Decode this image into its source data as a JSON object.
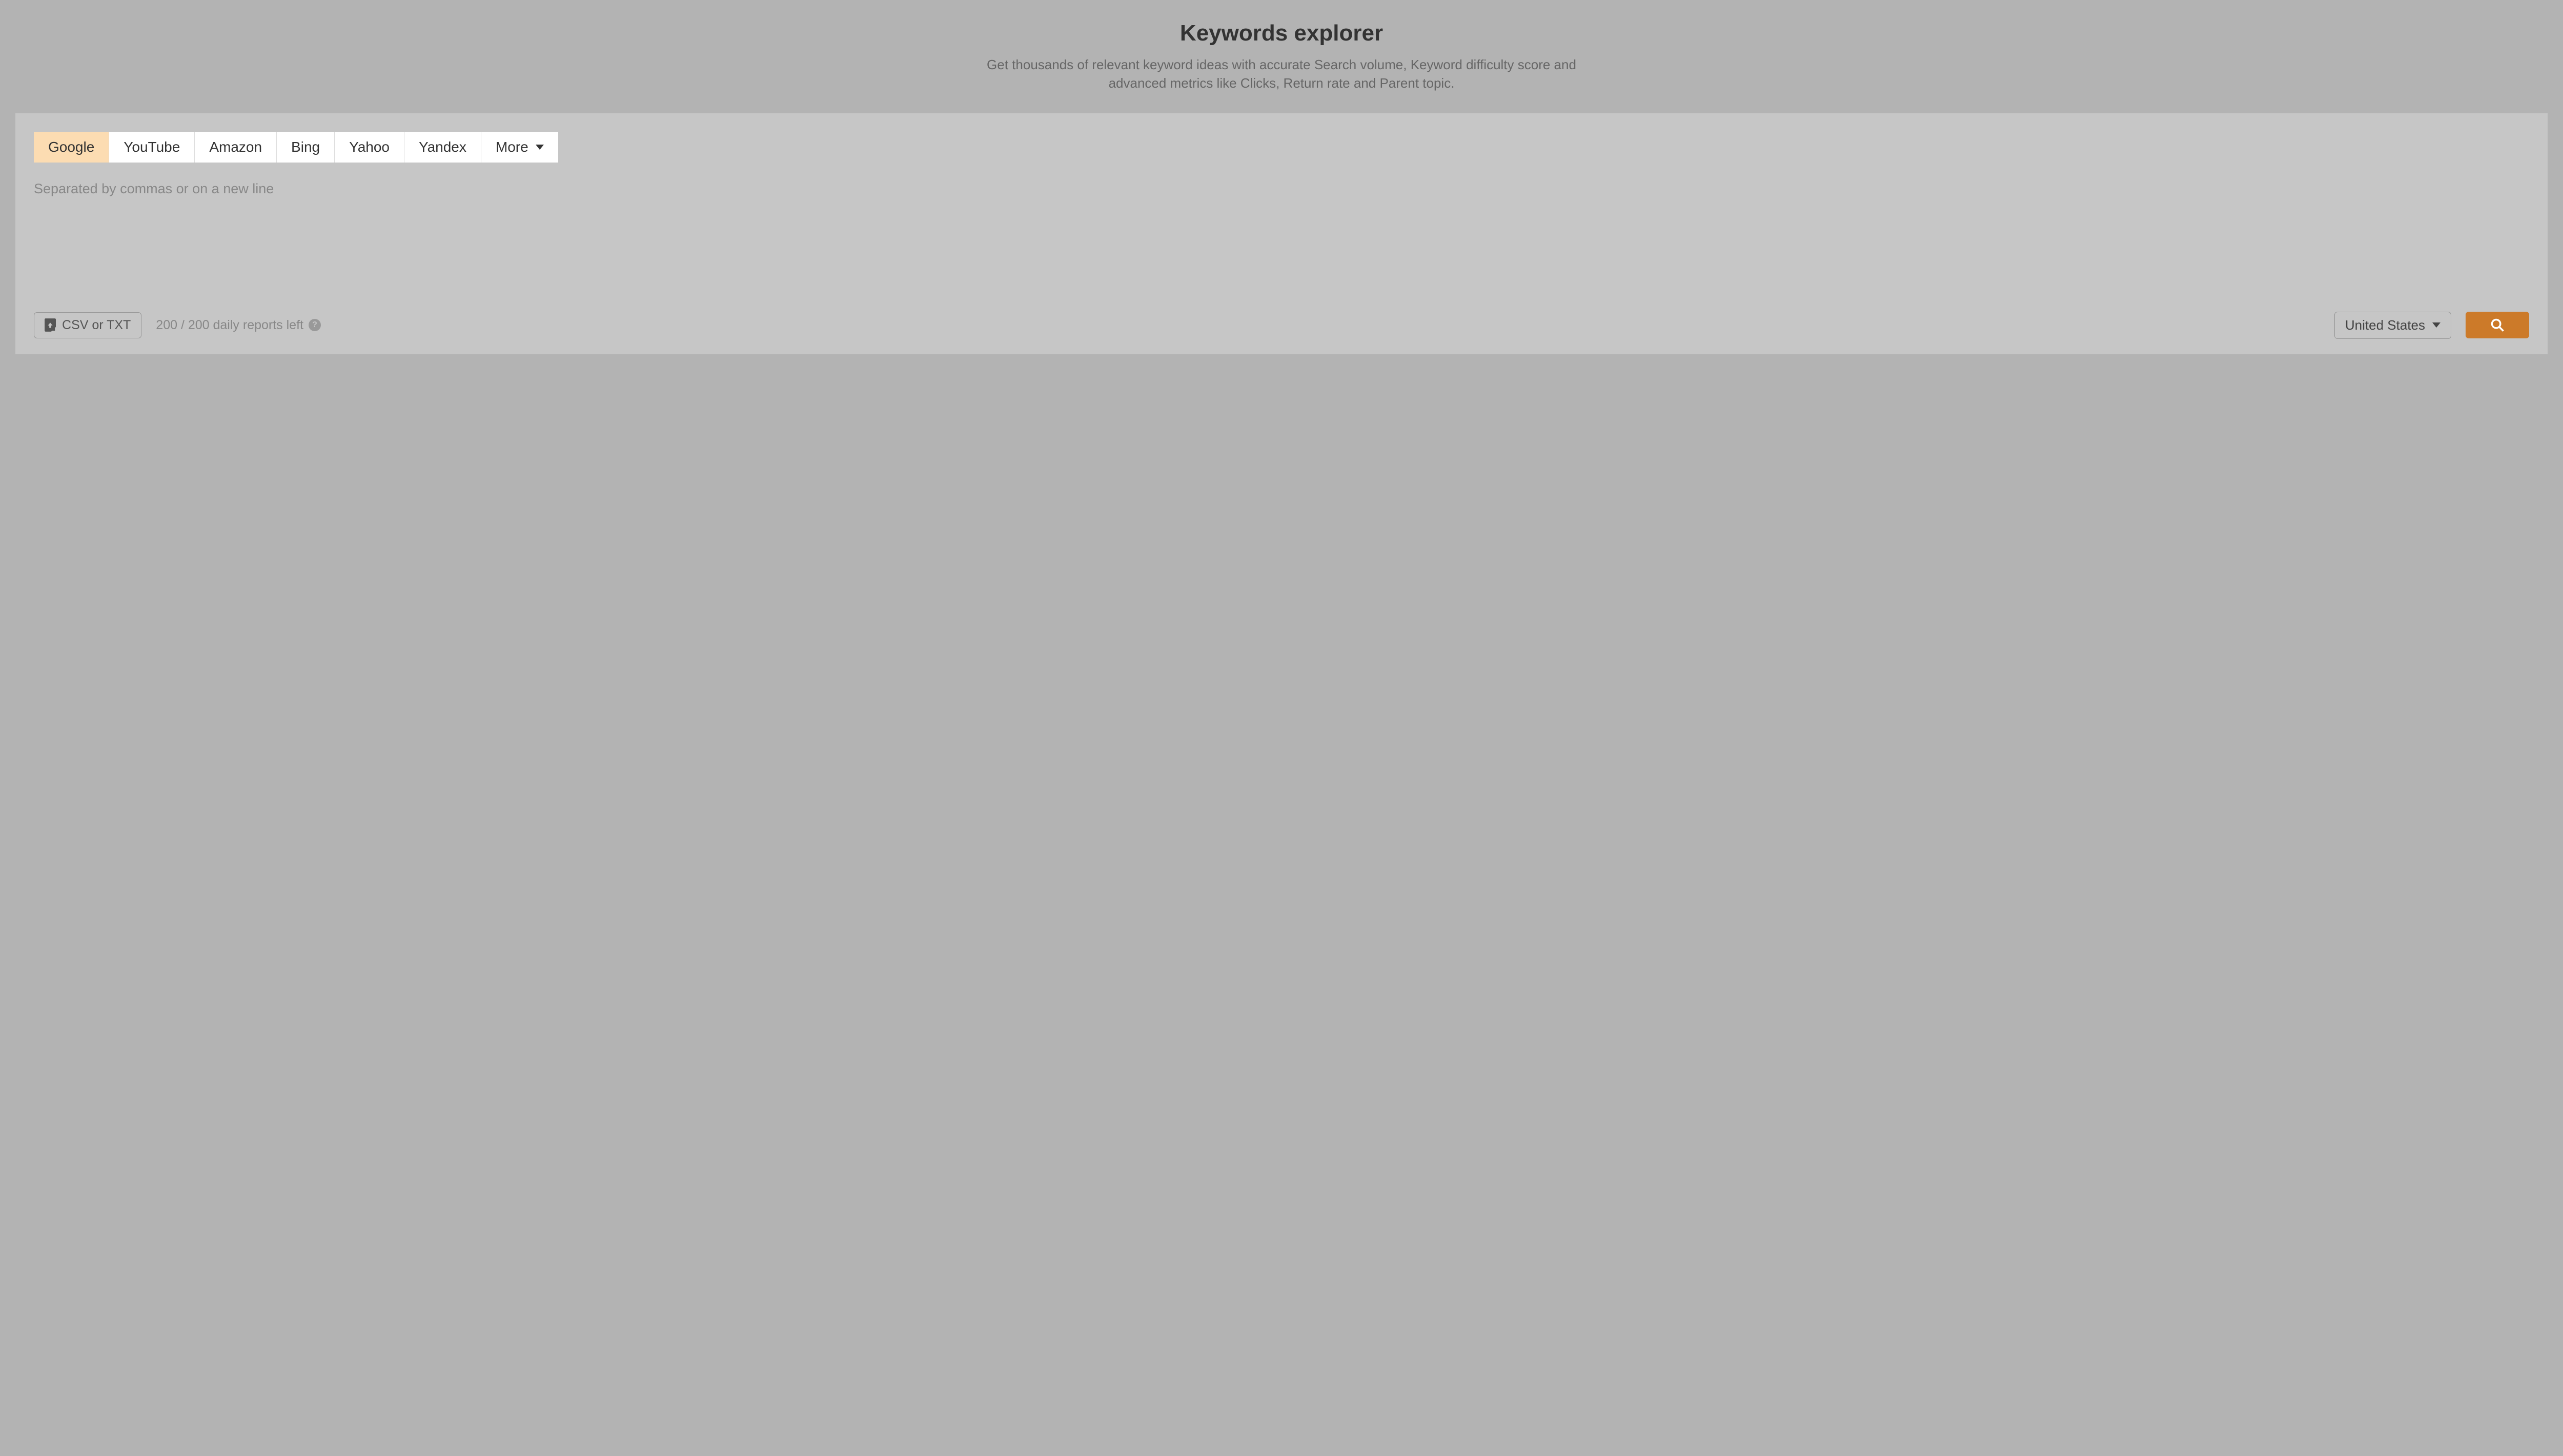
{
  "header": {
    "title": "Keywords explorer",
    "subtitle": "Get thousands of relevant keyword ideas with accurate Search volume, Keyword difficulty score and advanced metrics like Clicks, Return rate and Parent topic."
  },
  "tabs": {
    "items": [
      {
        "label": "Google",
        "active": true
      },
      {
        "label": "YouTube",
        "active": false
      },
      {
        "label": "Amazon",
        "active": false
      },
      {
        "label": "Bing",
        "active": false
      },
      {
        "label": "Yahoo",
        "active": false
      },
      {
        "label": "Yandex",
        "active": false
      }
    ],
    "more_label": "More"
  },
  "input": {
    "placeholder": "Separated by commas or on a new line",
    "value": ""
  },
  "footer": {
    "upload_label": "CSV or TXT",
    "reports_left": "200 / 200 daily reports left",
    "country": "United States"
  }
}
